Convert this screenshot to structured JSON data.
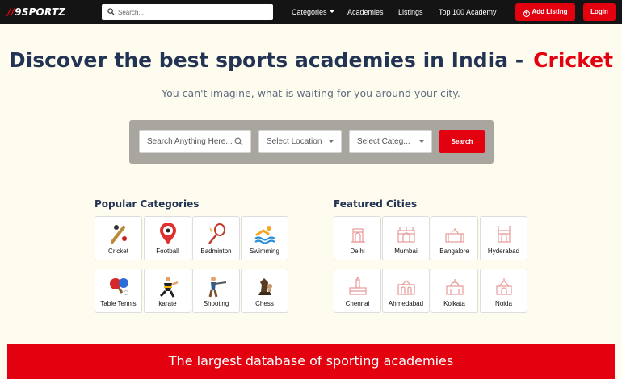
{
  "nav": {
    "logo_slash": "//",
    "logo_text": "9SPORTZ",
    "search_placeholder": "Search...",
    "links": [
      "Categories",
      "Academies",
      "Listings",
      "Top 100 Academy"
    ],
    "add_listing": "Add Listing",
    "login": "Login"
  },
  "hero": {
    "title": "Discover the best sports academies in India -",
    "highlight": "Cricket",
    "subtitle": "You can't imagine, what is waiting for you around your city."
  },
  "search": {
    "anything": "Search Anything Here...",
    "location": "Select Location",
    "category": "Select Categ...",
    "button": "Search"
  },
  "popular": {
    "title": "Popular Categories",
    "items": [
      "Cricket",
      "Football",
      "Badminton",
      "Swimming",
      "Table Tennis",
      "karate",
      "Shooting",
      "Chess"
    ]
  },
  "featured": {
    "title": "Featured Cities",
    "items": [
      "Delhi",
      "Mumbai",
      "Bangalore",
      "Hyderabad",
      "Chennai",
      "Ahmedabad",
      "Kolkata",
      "Noida"
    ]
  },
  "band": {
    "text": "The largest database of sporting academies"
  },
  "colors": {
    "accent": "#e3000f",
    "heading": "#233354",
    "background": "#fdfcee",
    "nav": "#141414"
  }
}
